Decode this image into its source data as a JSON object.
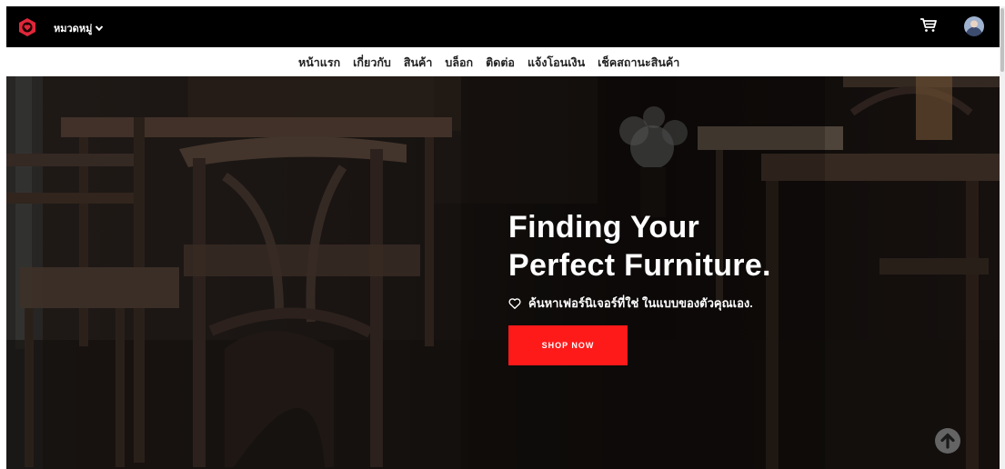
{
  "header": {
    "category_label": "หมวดหมู่",
    "icons": [
      "shield-logo-icon",
      "chevron-down-icon",
      "cart-icon",
      "avatar"
    ]
  },
  "nav": {
    "items": [
      "หน้าแรก",
      "เกี่ยวกับ",
      "สินค้า",
      "บล็อก",
      "ติดต่อ",
      "แจ้งโอนเงิน",
      "เช็คสถานะสินค้า"
    ]
  },
  "hero": {
    "title_line1": "Finding Your",
    "title_line2": "Perfect Furniture.",
    "subtitle": "ค้นหาเฟอร์นิเจอร์ที่ใช่ ในแบบของตัวคุณเอง.",
    "button_label": "SHOP NOW"
  },
  "colors": {
    "accent": "#ff1a1a",
    "topbar": "#000000",
    "logo": "#e0273a"
  }
}
